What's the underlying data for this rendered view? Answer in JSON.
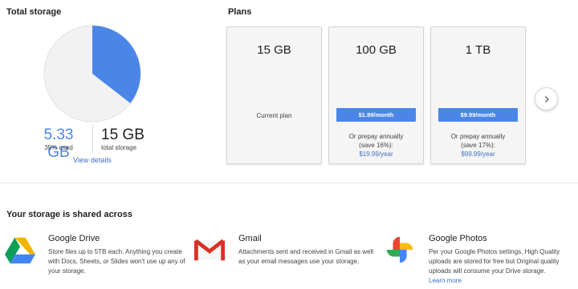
{
  "total_storage": {
    "title": "Total storage",
    "used_value": "5.33 GB",
    "used_percent_label": "35% used",
    "used_fraction": 0.3553,
    "total_value": "15 GB",
    "total_label": "total storage",
    "view_details": "View details",
    "colors": {
      "used": "#4a86e8",
      "free": "#f2f2f2"
    }
  },
  "plans": {
    "title": "Plans",
    "items": [
      {
        "size": "15 GB",
        "current_label": "Current plan"
      },
      {
        "size": "100 GB",
        "price_button": "$1.99/month",
        "prepay_line1": "Or prepay annually",
        "prepay_line2": "(save 16%):",
        "annual_price": "$19.99/year"
      },
      {
        "size": "1 TB",
        "price_button": "$9.99/month",
        "prepay_line1": "Or prepay annually",
        "prepay_line2": "(save 17%):",
        "annual_price": "$99.99/year"
      }
    ],
    "next_icon": "chevron-right-icon"
  },
  "shared": {
    "title": "Your storage is shared across",
    "services": [
      {
        "name": "Google Drive",
        "icon": "google-drive-icon",
        "description": "Store files up to 5TB each. Anything you create with Docs, Sheets, or Slides won't use up any of your storage."
      },
      {
        "name": "Gmail",
        "icon": "gmail-icon",
        "description": "Attachments sent and received in Gmail as well as your email messages use your storage."
      },
      {
        "name": "Google Photos",
        "icon": "google-photos-icon",
        "description": "Per your Google Photos settings, High Quality uploads are stored for free but Original quality uploads will consume your Drive storage.",
        "link": "Learn more"
      }
    ]
  }
}
